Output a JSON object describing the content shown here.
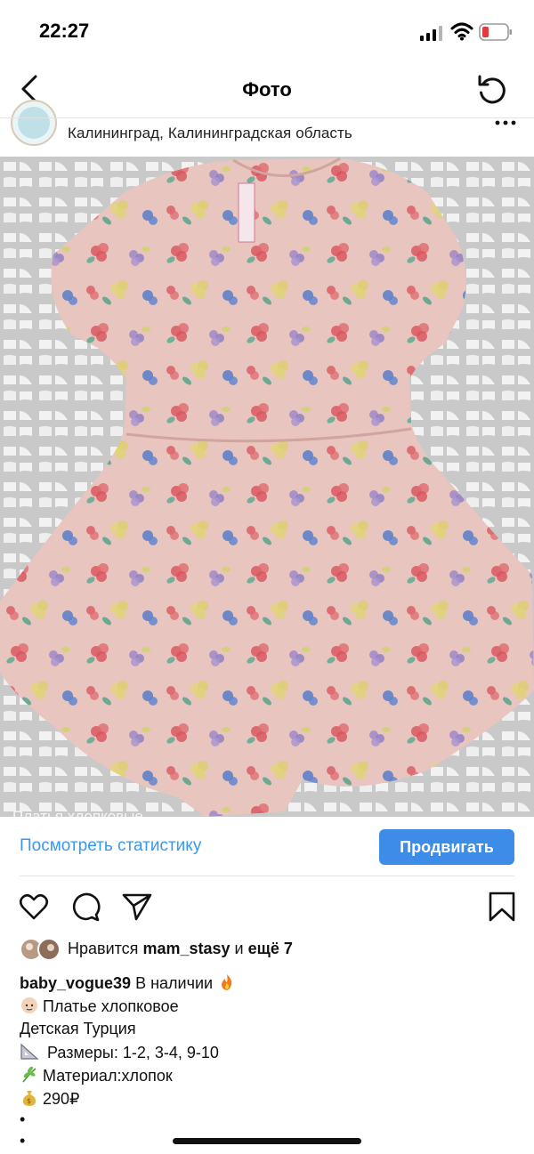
{
  "status_bar": {
    "time": "22:27"
  },
  "nav": {
    "title": "Фото"
  },
  "post": {
    "location": "Калининград, Калининградская область",
    "photo_caption_overlay": "Платья хлопковые",
    "stats_link": "Посмотреть статистику",
    "promote_button": "Продвигать"
  },
  "likes": {
    "prefix": "Нравится",
    "user": "mam_stasy",
    "middle": "и",
    "suffix": "ещё 7"
  },
  "caption": {
    "username": "baby_vogue39",
    "line1_text": "В наличии",
    "line2": "Платье хлопковое",
    "line3": "Детская Турция",
    "line4": "Размеры: 1-2, 3-4, 9-10",
    "line5": "Материал:хлопок",
    "line6": "290₽",
    "line7": "•",
    "line8": "•"
  },
  "icons": {
    "status": [
      "signal-icon",
      "wifi-icon",
      "battery-icon"
    ],
    "nav": [
      "back-icon",
      "refresh-icon"
    ],
    "actions": [
      "heart-icon",
      "comment-icon",
      "share-icon",
      "bookmark-icon"
    ]
  },
  "colors": {
    "accent": "#3897f0",
    "button": "#3d8de8",
    "battery_low": "#e33b3b",
    "dress_pink": "#e7c2bb",
    "fence": "#a9a9a9"
  }
}
